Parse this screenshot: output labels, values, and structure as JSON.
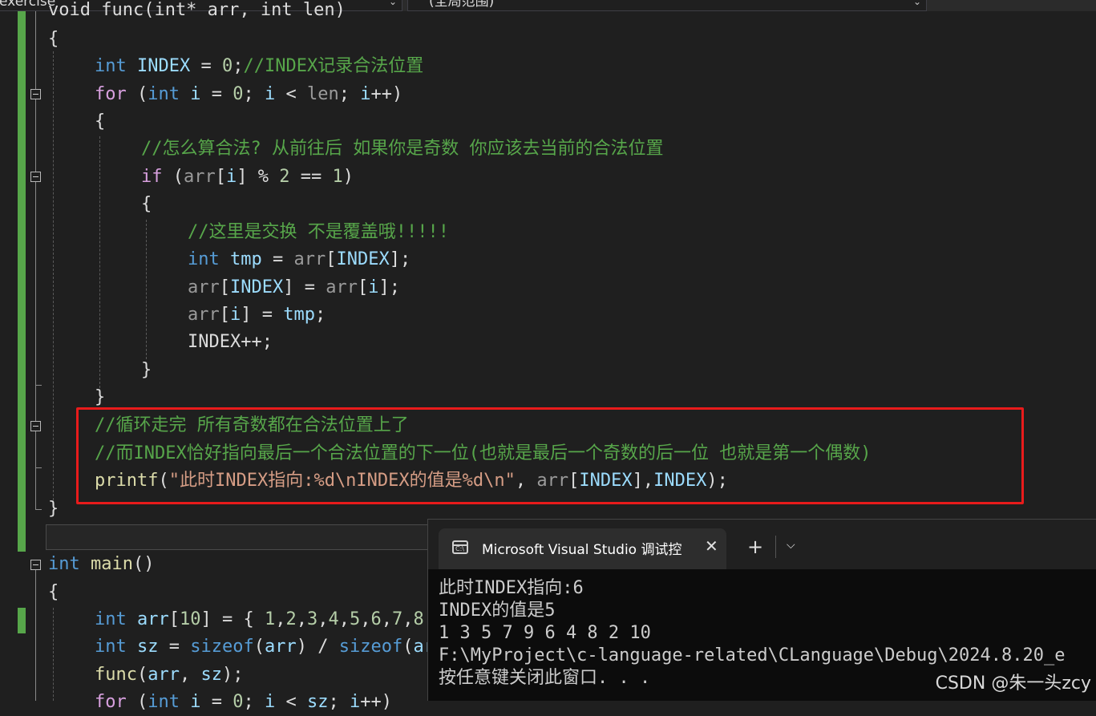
{
  "nav": {
    "project": "exercise",
    "scope": "(全局范围)"
  },
  "code": {
    "line_func": "void func(int* arr, int len)",
    "comment_index": "//INDEX记录合法位置",
    "comment_how": "//怎么算合法? 从前往后 如果你是奇数 你应该去当前的合法位置",
    "comment_swap": "//这里是交换 不是覆盖哦!!!!!",
    "comment_loop_done": "//循环走完 所有奇数都在合法位置上了",
    "comment_index_next": "//而INDEX恰好指向最后一个合法位置的下一位(也就是最后一个奇数的后一位 也就是第一个偶数)",
    "printf_str": "\"此时INDEX指向:%d\\nINDEX的值是%d\\n\""
  },
  "terminal": {
    "tab_title": "Microsoft Visual Studio 调试控制台",
    "icon_label": "C:\\",
    "close_glyph": "✕",
    "plus_glyph": "+",
    "dropdown_glyph": "⌵",
    "output": [
      "此时INDEX指向:6",
      "INDEX的值是5",
      "1 3 5 7 9 6 4 8 2 10",
      "F:\\MyProject\\c-language-related\\CLanguage\\Debug\\2024.8.20_e",
      "按任意键关闭此窗口. . ."
    ]
  },
  "watermark": "CSDN @朱一头zcy"
}
